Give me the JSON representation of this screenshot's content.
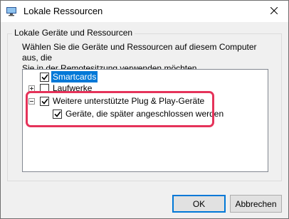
{
  "window": {
    "title": "Lokale Ressourcen",
    "close_glyph": "✕"
  },
  "group": {
    "label": "Lokale Geräte und Ressourcen",
    "description_line1": "Wählen Sie die Geräte und Ressourcen auf diesem Computer aus, die",
    "description_line2": "Sie in der Remotesitzung verwenden möchten."
  },
  "tree": {
    "items": [
      {
        "label": "Smartcards",
        "checked": true,
        "selected": true,
        "expander": "none"
      },
      {
        "label": "Laufwerke",
        "checked": false,
        "selected": false,
        "expander": "plus"
      },
      {
        "label": "Weitere unterstützte Plug & Play-Geräte",
        "checked": true,
        "selected": false,
        "expander": "minus"
      },
      {
        "label": "Geräte, die später angeschlossen werden",
        "checked": true,
        "selected": false,
        "expander": "none"
      }
    ]
  },
  "buttons": {
    "ok": "OK",
    "cancel": "Abbrechen"
  },
  "colors": {
    "selection": "#0078d7",
    "highlight": "#e5335a"
  },
  "icons": {
    "app": "remote-desktop-icon",
    "close": "close-icon"
  }
}
